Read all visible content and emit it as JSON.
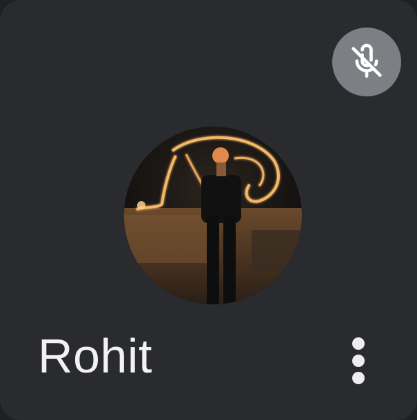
{
  "participant": {
    "name": "Rohit",
    "muted": true,
    "mute_icon": "mic-off-icon",
    "more_icon": "more-vert-icon"
  },
  "colors": {
    "tile_background": "#2a2b2f",
    "page_background": "#1f2023",
    "mute_badge": "#7c7f84",
    "text": "#f2f2f2"
  }
}
